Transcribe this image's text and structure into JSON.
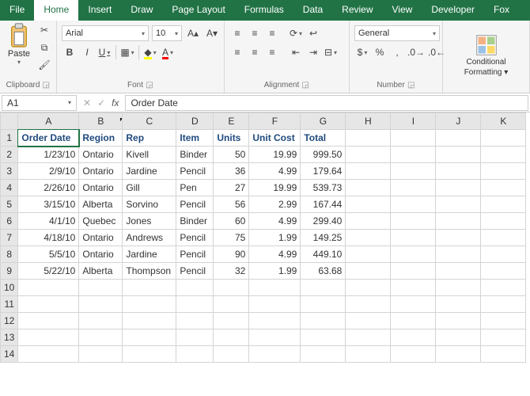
{
  "tabs": {
    "file": "File",
    "home": "Home",
    "insert": "Insert",
    "draw": "Draw",
    "pageLayout": "Page Layout",
    "formulas": "Formulas",
    "data": "Data",
    "review": "Review",
    "view": "View",
    "developer": "Developer",
    "foxit": "Fox"
  },
  "ribbon": {
    "clipboard": {
      "paste": "Paste",
      "label": "Clipboard"
    },
    "font": {
      "name": "Arial",
      "size": "10",
      "label": "Font"
    },
    "alignment": {
      "label": "Alignment"
    },
    "number": {
      "format": "General",
      "label": "Number"
    },
    "styles": {
      "cond": "Conditional",
      "fmt": "Formatting",
      "dd": "▾"
    }
  },
  "fx": {
    "cell": "A1",
    "dd": "▾",
    "value": "Order Date",
    "fxLabel": "fx"
  },
  "chart_data": {
    "type": "table",
    "columns": [
      "Order Date",
      "Region",
      "Rep",
      "Item",
      "Units",
      "Unit Cost",
      "Total"
    ],
    "rows": [
      {
        "Order Date": "1/23/10",
        "Region": "Ontario",
        "Rep": "Kivell",
        "Item": "Binder",
        "Units": 50,
        "Unit Cost": 19.99,
        "Total": 999.5
      },
      {
        "Order Date": "2/9/10",
        "Region": "Ontario",
        "Rep": "Jardine",
        "Item": "Pencil",
        "Units": 36,
        "Unit Cost": 4.99,
        "Total": 179.64
      },
      {
        "Order Date": "2/26/10",
        "Region": "Ontario",
        "Rep": "Gill",
        "Item": "Pen",
        "Units": 27,
        "Unit Cost": 19.99,
        "Total": 539.73
      },
      {
        "Order Date": "3/15/10",
        "Region": "Alberta",
        "Rep": "Sorvino",
        "Item": "Pencil",
        "Units": 56,
        "Unit Cost": 2.99,
        "Total": 167.44
      },
      {
        "Order Date": "4/1/10",
        "Region": "Quebec",
        "Rep": "Jones",
        "Item": "Binder",
        "Units": 60,
        "Unit Cost": 4.99,
        "Total": 299.4
      },
      {
        "Order Date": "4/18/10",
        "Region": "Ontario",
        "Rep": "Andrews",
        "Item": "Pencil",
        "Units": 75,
        "Unit Cost": 1.99,
        "Total": 149.25
      },
      {
        "Order Date": "5/5/10",
        "Region": "Ontario",
        "Rep": "Jardine",
        "Item": "Pencil",
        "Units": 90,
        "Unit Cost": 4.99,
        "Total": 449.1
      },
      {
        "Order Date": "5/22/10",
        "Region": "Alberta",
        "Rep": "Thompson",
        "Item": "Pencil",
        "Units": 32,
        "Unit Cost": 1.99,
        "Total": 63.68
      }
    ]
  },
  "colLetters": [
    "A",
    "B",
    "C",
    "D",
    "E",
    "F",
    "G",
    "H",
    "I",
    "J",
    "K"
  ]
}
